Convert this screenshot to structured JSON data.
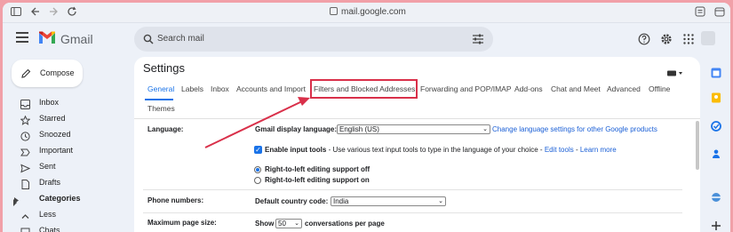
{
  "browser": {
    "url": "mail.google.com",
    "icons": [
      "sidebar-icon",
      "back-icon",
      "forward-icon",
      "reload-icon",
      "lock-icon",
      "reader-icon",
      "share-icon"
    ]
  },
  "header": {
    "app_name": "Gmail",
    "search_placeholder": "Search mail",
    "icons": [
      "menu-icon",
      "gmail-logo",
      "search-icon",
      "search-options-icon",
      "help-icon",
      "settings-icon",
      "apps-icon"
    ]
  },
  "compose": {
    "label": "Compose"
  },
  "nav": {
    "items": [
      {
        "label": "Inbox",
        "icon": "inbox-icon",
        "bold": false
      },
      {
        "label": "Starred",
        "icon": "star-icon",
        "bold": false
      },
      {
        "label": "Snoozed",
        "icon": "clock-icon",
        "bold": false
      },
      {
        "label": "Important",
        "icon": "important-icon",
        "bold": false
      },
      {
        "label": "Sent",
        "icon": "send-icon",
        "bold": false
      },
      {
        "label": "Drafts",
        "icon": "draft-icon",
        "bold": false
      },
      {
        "label": "Categories",
        "icon": "label-icon",
        "bold": true
      },
      {
        "label": "Less",
        "icon": "chevron-up-icon",
        "bold": false
      },
      {
        "label": "Chats",
        "icon": "chat-icon",
        "bold": false
      }
    ]
  },
  "settings": {
    "title": "Settings",
    "tabs": [
      {
        "label": "General",
        "active": true
      },
      {
        "label": "Labels",
        "active": false
      },
      {
        "label": "Inbox",
        "active": false
      },
      {
        "label": "Accounts and Import",
        "active": false
      },
      {
        "label": "Filters and Blocked Addresses",
        "active": false
      },
      {
        "label": "Forwarding and POP/IMAP",
        "active": false
      },
      {
        "label": "Add-ons",
        "active": false
      },
      {
        "label": "Chat and Meet",
        "active": false
      },
      {
        "label": "Advanced",
        "active": false
      },
      {
        "label": "Offline",
        "active": false
      },
      {
        "label": "Themes",
        "active": false
      }
    ],
    "highlighted_tab": "Filters and Blocked Addresses",
    "annotation_color": "#d9304a"
  },
  "language": {
    "label": "Language:",
    "display_label": "Gmail display language:",
    "display_value": "English (US)",
    "change_link": "Change language settings for other Google products",
    "input_tools_label": "Enable input tools",
    "input_tools_desc": " - Use various text input tools to type in the language of your choice - ",
    "edit_tools_link": "Edit tools",
    "dash": " - ",
    "learn_more_link": "Learn more",
    "input_tools_checked": true,
    "rtl_on_label": "Right-to-left editing support off",
    "rtl_off_label": "Right-to-left editing support on",
    "rtl_selected": "off"
  },
  "phone": {
    "label": "Phone numbers:",
    "country_label": "Default country code:",
    "country_value": "India"
  },
  "page_size": {
    "label": "Maximum page size:",
    "show": "Show",
    "value": "50",
    "suffix": "conversations per page"
  },
  "colors": {
    "accent": "#1a73e8",
    "link": "#1a5fd6",
    "background": "#edf1f8"
  }
}
